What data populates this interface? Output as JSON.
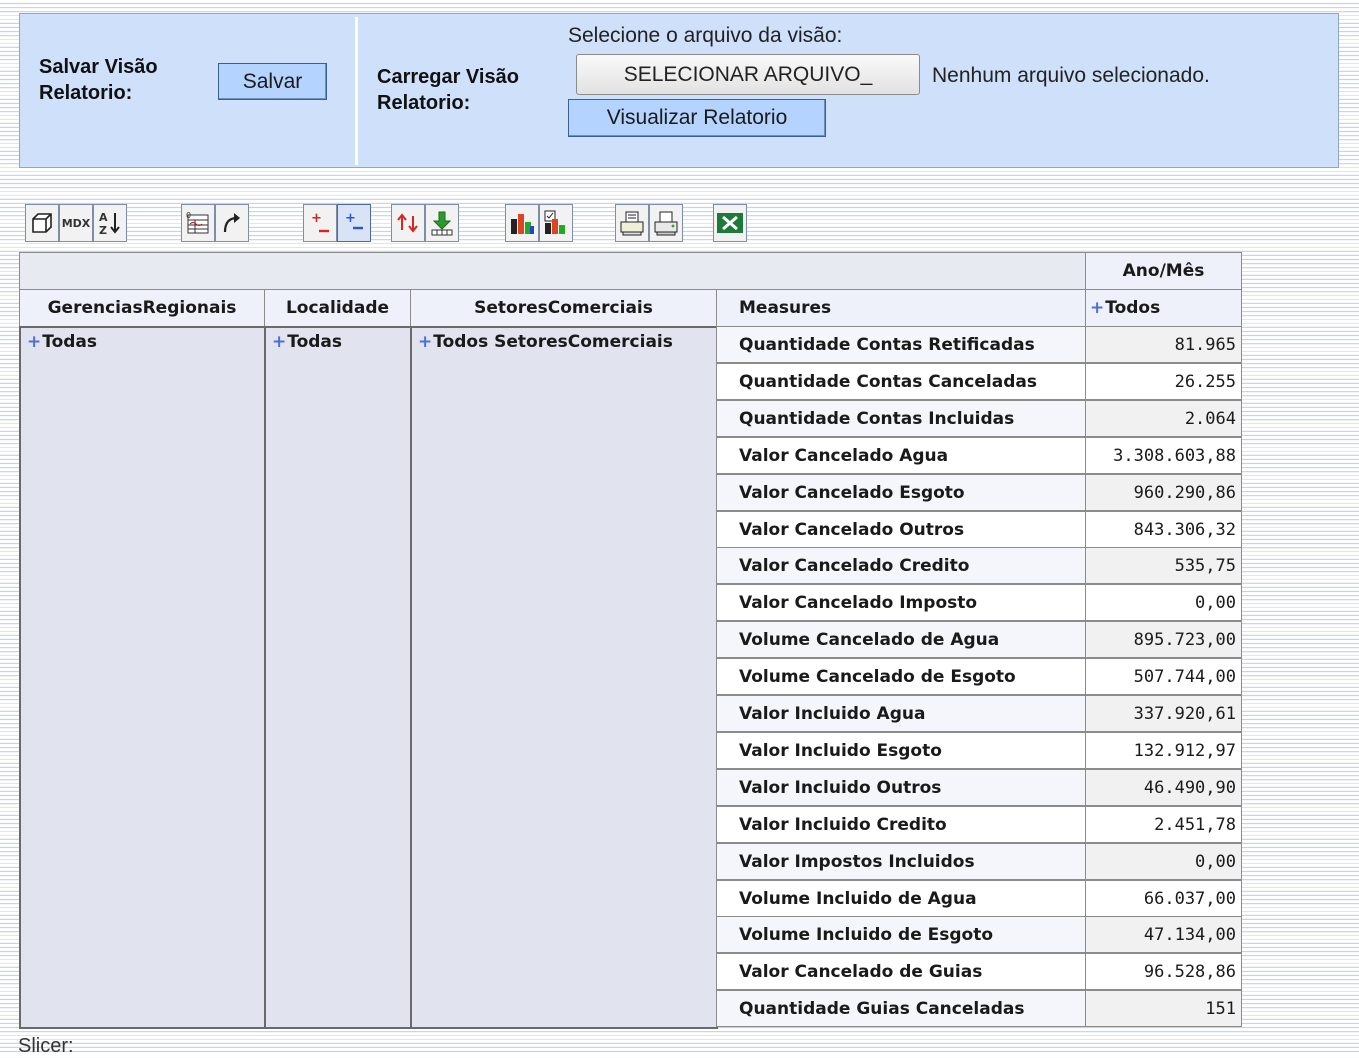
{
  "save_section": {
    "label_line1": "Salvar Visão",
    "label_line2": "Relatorio:",
    "button": "Salvar"
  },
  "load_section": {
    "label_line1": "Carregar Visão",
    "label_line2": "Relatorio:",
    "file_prompt": "Selecione o arquivo da visão:",
    "file_button": "SELECIONAR ARQUIVO_",
    "file_status": "Nenhum arquivo selecionado.",
    "view_button": "Visualizar Relatorio"
  },
  "toolbar": {
    "icons": [
      "cube-navigator-icon",
      "mdx-icon",
      "sort-az-icon",
      "show-parent-icon",
      "swap-axes-icon",
      "expand-all-icon",
      "collapse-icon",
      "drill-through-icon",
      "export-down-icon",
      "chart-icon",
      "chart-config-icon",
      "print-settings-icon",
      "print-icon",
      "excel-icon"
    ],
    "mdx_text": "MDX"
  },
  "pivot": {
    "column_dimension": "Ano/Mês",
    "column_member": "Todos",
    "headers": [
      "GerenciasRegionais",
      "Localidade",
      "SetoresComerciais",
      "Measures"
    ],
    "row_members": [
      "Todas",
      "Todas",
      "Todos SetoresComerciais"
    ],
    "rows": [
      {
        "measure": "Quantidade Contas Retificadas",
        "value": "81.965"
      },
      {
        "measure": "Quantidade Contas Canceladas",
        "value": "26.255"
      },
      {
        "measure": "Quantidade Contas Incluidas",
        "value": "2.064"
      },
      {
        "measure": "Valor Cancelado Agua",
        "value": "3.308.603,88"
      },
      {
        "measure": "Valor Cancelado Esgoto",
        "value": "960.290,86"
      },
      {
        "measure": "Valor Cancelado Outros",
        "value": "843.306,32"
      },
      {
        "measure": "Valor Cancelado Credito",
        "value": "535,75"
      },
      {
        "measure": "Valor Cancelado Imposto",
        "value": "0,00"
      },
      {
        "measure": "Volume Cancelado de Agua",
        "value": "895.723,00"
      },
      {
        "measure": "Volume Cancelado de Esgoto",
        "value": "507.744,00"
      },
      {
        "measure": "Valor Incluido Agua",
        "value": "337.920,61"
      },
      {
        "measure": "Valor Incluido Esgoto",
        "value": "132.912,97"
      },
      {
        "measure": "Valor Incluido Outros",
        "value": "46.490,90"
      },
      {
        "measure": "Valor Incluido Credito",
        "value": "2.451,78"
      },
      {
        "measure": "Valor Impostos Incluidos",
        "value": "0,00"
      },
      {
        "measure": "Volume Incluido de Agua",
        "value": "66.037,00"
      },
      {
        "measure": "Volume Incluido de Esgoto",
        "value": "47.134,00"
      },
      {
        "measure": "Valor Cancelado de Guias",
        "value": "96.528,86"
      },
      {
        "measure": "Quantidade Guias Canceladas",
        "value": "151"
      }
    ]
  },
  "slicer_label": "Slicer:",
  "colors": {
    "panel_bg": "#cfe0fb",
    "button_bg": "#b5d3ff",
    "plus": "#4f6fd8",
    "dim_bg": "#e1e3ef"
  }
}
